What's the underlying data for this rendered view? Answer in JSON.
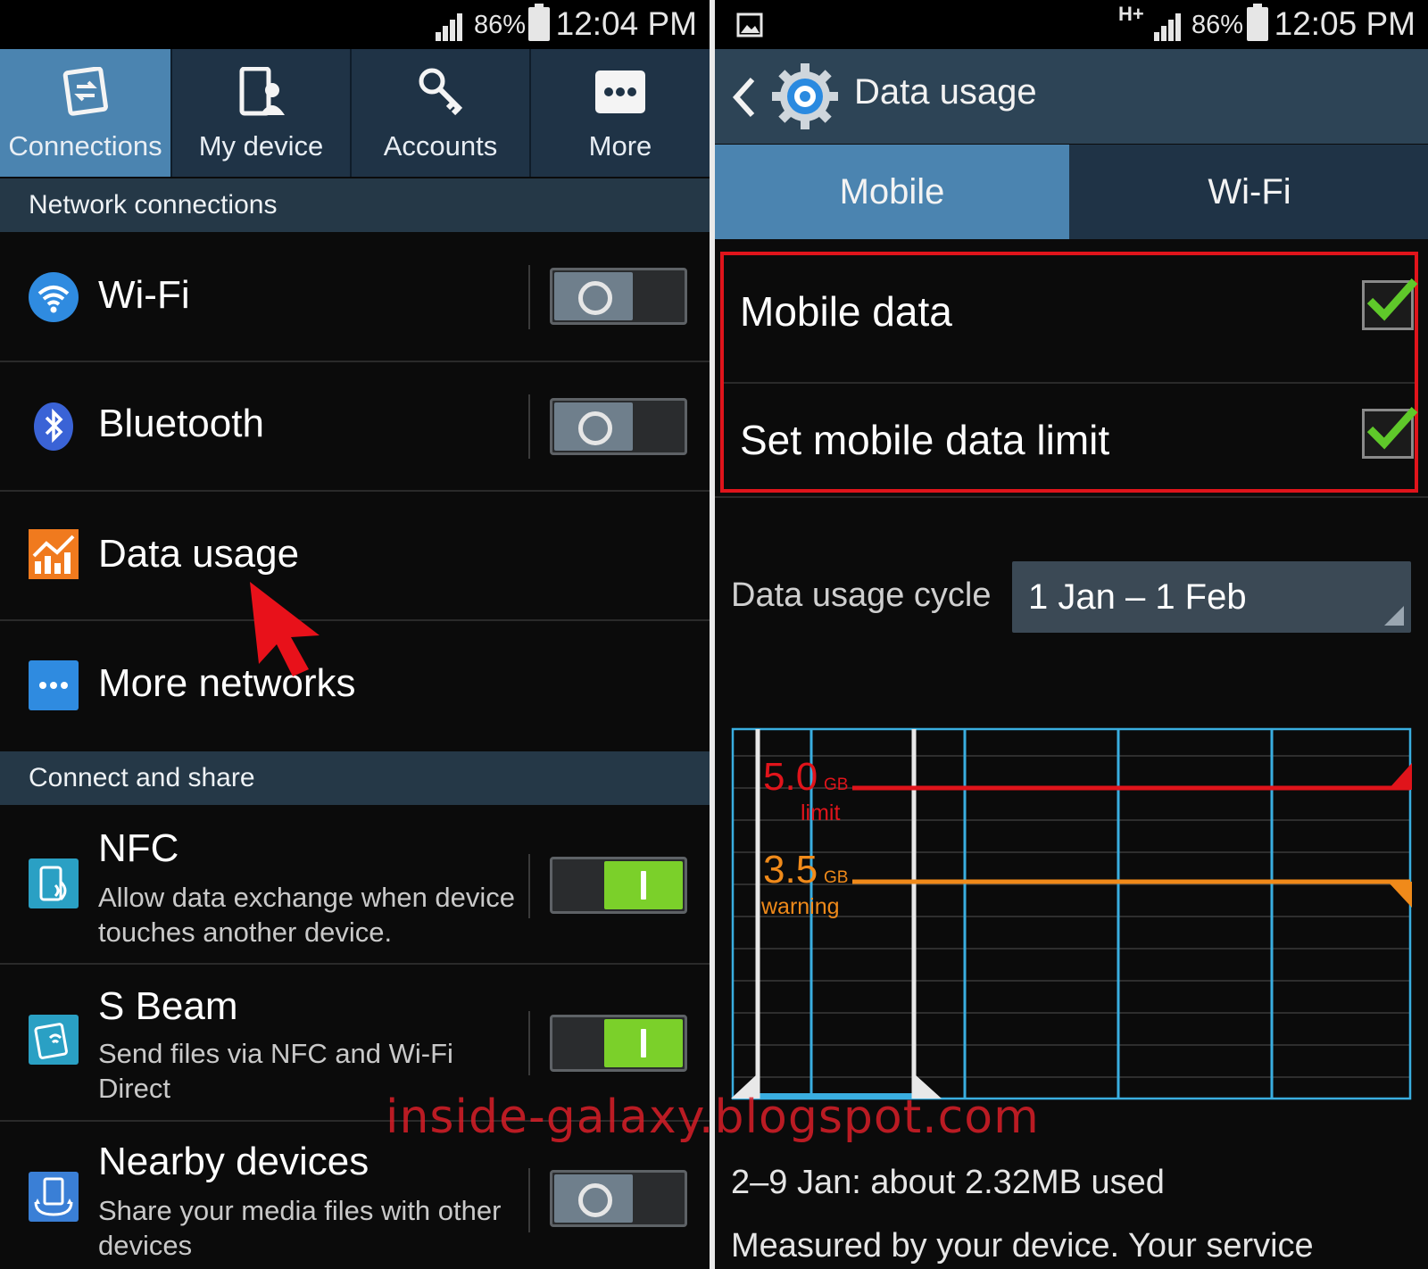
{
  "left": {
    "status": {
      "battery": "86%",
      "time": "12:04 PM"
    },
    "tabs": [
      {
        "label": "Connections",
        "icon": "connections-icon",
        "active": true
      },
      {
        "label": "My device",
        "icon": "my-device-icon",
        "active": false
      },
      {
        "label": "Accounts",
        "icon": "accounts-icon",
        "active": false
      },
      {
        "label": "More",
        "icon": "more-icon",
        "active": false
      }
    ],
    "sections": {
      "network": "Network connections",
      "connect": "Connect and share"
    },
    "items": {
      "wifi": {
        "title": "Wi-Fi",
        "icon": "wifi-icon",
        "on": false
      },
      "bluetooth": {
        "title": "Bluetooth",
        "icon": "bluetooth-icon",
        "on": false
      },
      "data_usage": {
        "title": "Data usage",
        "icon": "data-usage-icon"
      },
      "more_networks": {
        "title": "More networks",
        "icon": "more-networks-icon"
      },
      "nfc": {
        "title": "NFC",
        "subtitle": "Allow data exchange when device touches another device.",
        "icon": "nfc-icon",
        "on": true
      },
      "sbeam": {
        "title": "S Beam",
        "subtitle": "Send files via NFC and Wi-Fi Direct",
        "icon": "s-beam-icon",
        "on": true
      },
      "nearby": {
        "title": "Nearby devices",
        "subtitle": "Share your media files with other devices",
        "icon": "nearby-devices-icon",
        "on": false
      }
    }
  },
  "right": {
    "status": {
      "network": "H+",
      "battery": "86%",
      "time": "12:05 PM"
    },
    "header": {
      "title": "Data usage"
    },
    "tabs": [
      {
        "label": "Mobile",
        "active": true
      },
      {
        "label": "Wi-Fi",
        "active": false
      }
    ],
    "options": {
      "mobile_data": {
        "label": "Mobile data",
        "checked": true
      },
      "set_limit": {
        "label": "Set mobile data limit",
        "checked": true
      }
    },
    "cycle": {
      "label": "Data usage cycle",
      "value": "1 Jan – 1 Feb"
    },
    "summary": "2–9 Jan: about 2.32MB used",
    "measured": "Measured by your device. Your service"
  },
  "chart_data": {
    "type": "line",
    "limit": {
      "value": "5.0",
      "unit": "GB",
      "label": "limit",
      "color": "#e0141b"
    },
    "warning": {
      "value": "3.5",
      "unit": "GB",
      "label": "warning",
      "color": "#f08a1a"
    }
  },
  "watermark": "inside-galaxy.blogspot.com",
  "colors": {
    "accent": "#4b84b0",
    "toggle_on": "#7bd02a",
    "check": "#5fc82a",
    "highlight": "#e0141b"
  }
}
